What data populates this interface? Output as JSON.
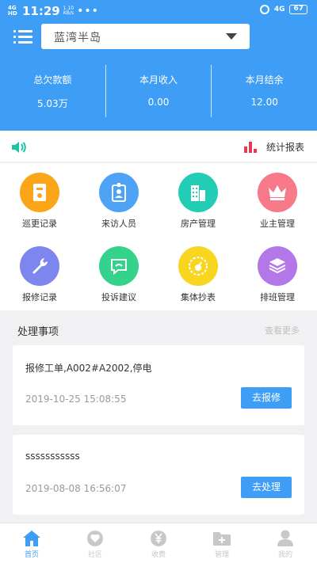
{
  "status_bar": {
    "network": "4G HD",
    "time": "11:29",
    "speed_value": "1.10",
    "speed_unit": "KB/s",
    "dots": "•••",
    "signal": "4G",
    "battery": "67"
  },
  "header": {
    "community_select": "蓝湾半岛"
  },
  "stats": [
    {
      "label": "总欠款额",
      "value": "5.03万"
    },
    {
      "label": "本月收入",
      "value": "0.00"
    },
    {
      "label": "本月结余",
      "value": "12.00"
    }
  ],
  "notice_bar": {
    "report_label": "统计报表"
  },
  "functions": [
    {
      "label": "巡更记录",
      "icon": "patrol-icon",
      "color": "#fba519"
    },
    {
      "label": "来访人员",
      "icon": "visitor-badge-icon",
      "color": "#4fa3f6"
    },
    {
      "label": "房产管理",
      "icon": "building-icon",
      "color": "#23ccb4"
    },
    {
      "label": "业主管理",
      "icon": "crown-icon",
      "color": "#f7798a"
    },
    {
      "label": "报修记录",
      "icon": "wrench-icon",
      "color": "#7d86ee"
    },
    {
      "label": "投诉建议",
      "icon": "message-icon",
      "color": "#33d38c"
    },
    {
      "label": "集体抄表",
      "icon": "meter-icon",
      "color": "#f8d51e"
    },
    {
      "label": "排班管理",
      "icon": "layers-icon",
      "color": "#b377e8"
    }
  ],
  "tasks_section": {
    "title": "处理事项",
    "more": "查看更多"
  },
  "tasks": [
    {
      "title": "报修工单,A002#A2002,停电",
      "time": "2019-10-25 15:08:55",
      "action": "去报修"
    },
    {
      "title": "sssssssssss",
      "time": "2019-08-08 16:56:07",
      "action": "去处理"
    }
  ],
  "tabbar": [
    {
      "label": "首页",
      "icon": "home-icon",
      "active": true
    },
    {
      "label": "社区",
      "icon": "community-icon",
      "active": false
    },
    {
      "label": "收费",
      "icon": "fee-icon",
      "active": false
    },
    {
      "label": "管理",
      "icon": "folder-icon",
      "active": false
    },
    {
      "label": "我的",
      "icon": "profile-icon",
      "active": false
    }
  ],
  "colors": {
    "primary": "#3e9ef5",
    "report_icon": "#e63a54",
    "speaker_icon": "#1fc3a4",
    "tab_inactive": "#c8c8c8"
  }
}
